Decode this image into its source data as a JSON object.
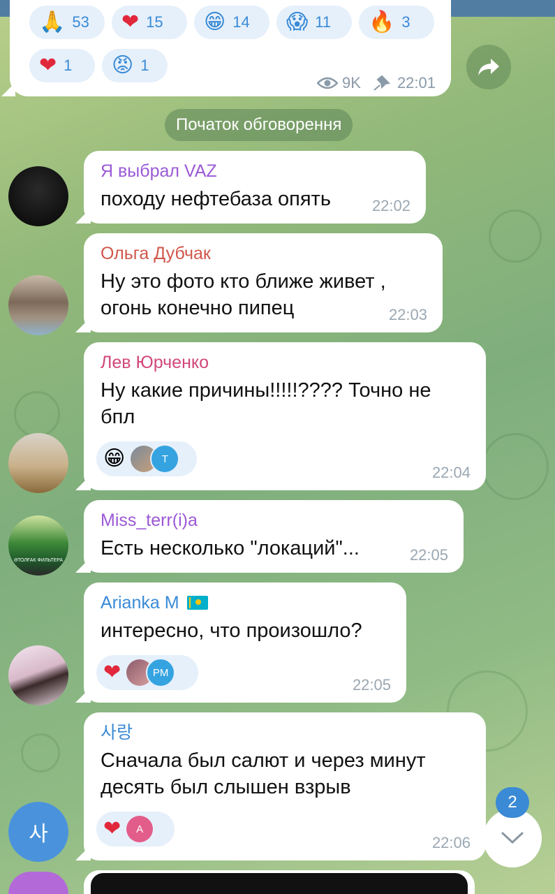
{
  "post": {
    "reactions_row1": [
      {
        "icon": "folded-hands-icon",
        "emoji": "🙏",
        "count": "53"
      },
      {
        "icon": "heart-icon",
        "emoji": "❤",
        "count": "15"
      },
      {
        "icon": "grinning-face-icon",
        "emoji": "😁",
        "count": "14"
      },
      {
        "icon": "screaming-face-icon",
        "emoji": "😱",
        "count": "11"
      },
      {
        "icon": "fire-icon",
        "emoji": "🔥",
        "count": "3"
      }
    ],
    "reactions_row2": [
      {
        "icon": "heart-on-fire-icon",
        "emoji": "❤",
        "count": "1"
      },
      {
        "icon": "angry-face-icon",
        "emoji": "😡",
        "count": "1"
      }
    ],
    "views": "9K",
    "time": "22:01"
  },
  "service_message": "Початок обговорення",
  "messages": [
    {
      "sender": "Я выбрал VAZ",
      "sender_color": "#9b59d6",
      "text": "походу нефтебаза опять",
      "time": "22:02"
    },
    {
      "sender": "Ольга Дубчак",
      "sender_color": "#d1564b",
      "text": "Ну это фото кто ближе живет , огонь конечно пипец",
      "time": "22:03"
    },
    {
      "sender": "Лев Юрченко",
      "sender_color": "#d1487a",
      "text": "Ну какие причины!!!!!???? Точно не бпл",
      "time": "22:04",
      "reaction": "😁",
      "reaction_icon": "grinning-face-icon",
      "reactor_initial": "Т"
    },
    {
      "sender": "Miss_terr(i)a",
      "sender_color": "#9b59d6",
      "text": "Есть несколько \"локаций\"...",
      "time": "22:05"
    },
    {
      "sender": "Arianka M",
      "sender_color": "#3a8ad6",
      "text": "интересно, что произошло?",
      "time": "22:05",
      "reaction": "❤",
      "reaction_icon": "heart-icon",
      "reactor_initial": "PM"
    },
    {
      "sender": "사랑",
      "sender_color": "#3a8ad6",
      "text": "Сначала был салют и через минут десять был слышен взрыв",
      "time": "22:06",
      "reaction": "❤",
      "reaction_icon": "heart-icon",
      "reactor_initial": "A"
    }
  ],
  "avatar_initial": "사",
  "avatar_4_caption": "ӘТОЛҒАК ФИЛЬТЕРА",
  "unread_count": "2",
  "colors": {
    "accent": "#3a8ad6",
    "topbar": "#527da3"
  }
}
